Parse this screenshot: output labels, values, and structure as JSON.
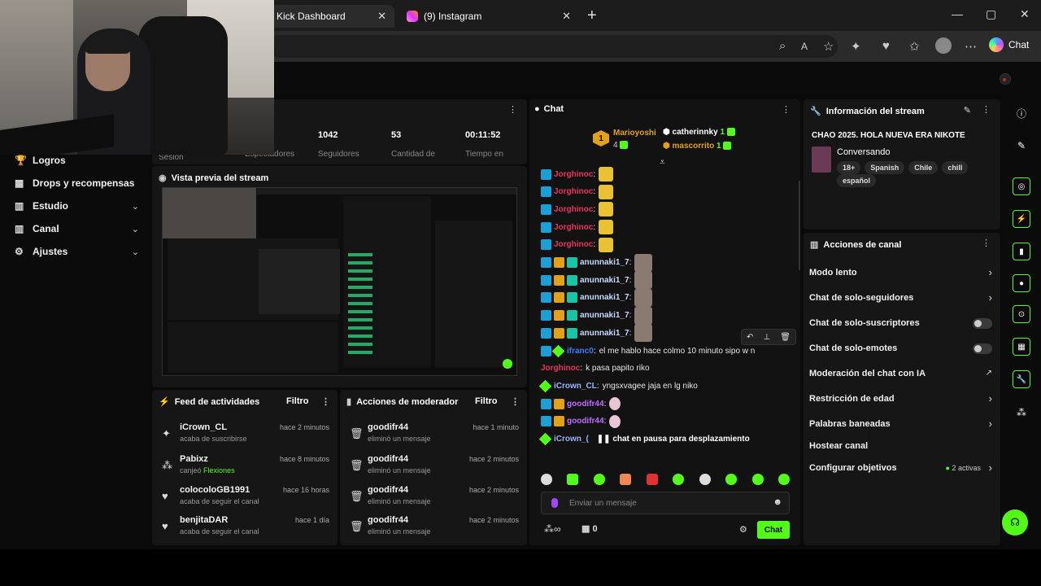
{
  "browser": {
    "tabs": [
      {
        "label": "Kick Dashboard"
      },
      {
        "label": "(9) Instagram"
      }
    ],
    "copilot_label": "Chat"
  },
  "nav": {
    "items": [
      {
        "label": "Logros",
        "icon": "trophy-icon"
      },
      {
        "label": "Drops y recompensas",
        "icon": "gift-icon"
      },
      {
        "label": "Estudio",
        "icon": "bars-icon"
      },
      {
        "label": "Canal",
        "icon": "bars-icon"
      },
      {
        "label": "Ajustes",
        "icon": "gear-icon"
      }
    ]
  },
  "stats": {
    "items": [
      {
        "value": "",
        "label": "Sesión"
      },
      {
        "value": "",
        "label": "Espectadores"
      },
      {
        "value": "1042",
        "label": "Seguidores"
      },
      {
        "value": "53",
        "label": "Cantidad de"
      },
      {
        "value": "00:11:52",
        "label": "Tiempo en"
      }
    ]
  },
  "preview": {
    "title": "Vista previa del stream"
  },
  "feed": {
    "title": "Feed de actividades",
    "filter": "Filtro",
    "items": [
      {
        "name": "iCrown_CL",
        "sub": "acaba de suscribirse",
        "time": "hace 2 minutos",
        "highlight": ""
      },
      {
        "name": "Pabixz",
        "sub": "canjeó",
        "time": "hace 8 minutos",
        "highlight": "Flexiones"
      },
      {
        "name": "colocoloGB1991",
        "sub": "acaba de seguir el canal",
        "time": "hace 16 horas",
        "highlight": ""
      },
      {
        "name": "benjitaDAR",
        "sub": "acaba de seguir el canal",
        "time": "hace 1 día",
        "highlight": ""
      }
    ]
  },
  "mod": {
    "title": "Acciones de moderador",
    "filter": "Filtro",
    "items": [
      {
        "name": "goodifr44",
        "sub": "eliminó un mensaje",
        "time": "hace 1 minuto"
      },
      {
        "name": "goodifr44",
        "sub": "eliminó un mensaje",
        "time": "hace 2 minutos"
      },
      {
        "name": "goodifr44",
        "sub": "eliminó un mensaje",
        "time": "hace 2 minutos"
      },
      {
        "name": "goodifr44",
        "sub": "eliminó un mensaje",
        "time": "hace 2 minutos"
      }
    ]
  },
  "chat": {
    "title": "Chat",
    "leaders": {
      "top": {
        "name": "Marioyoshi",
        "count": "4",
        "rank": "1"
      },
      "second": {
        "name": "catherinnky",
        "count": "1"
      },
      "third": {
        "name": "mascorrito",
        "count": "1"
      }
    },
    "messages": [
      {
        "user": "Jorghinoc",
        "text": "",
        "emote": "pika",
        "badges": 1,
        "color": "#e8335c"
      },
      {
        "user": "Jorghinoc",
        "text": "",
        "emote": "pika",
        "badges": 1,
        "color": "#e8335c"
      },
      {
        "user": "Jorghinoc",
        "text": "",
        "emote": "pika",
        "badges": 1,
        "color": "#e8335c"
      },
      {
        "user": "Jorghinoc",
        "text": "",
        "emote": "pika",
        "badges": 1,
        "color": "#e8335c"
      },
      {
        "user": "Jorghinoc",
        "text": "",
        "emote": "pika",
        "badges": 1,
        "color": "#e8335c"
      },
      {
        "user": "anunnaki1_7",
        "text": "",
        "emote": "face",
        "badges": 3,
        "color": "#c9d9ff"
      },
      {
        "user": "anunnaki1_7",
        "text": "",
        "emote": "face",
        "badges": 3,
        "color": "#c9d9ff"
      },
      {
        "user": "anunnaki1_7",
        "text": "",
        "emote": "face",
        "badges": 3,
        "color": "#c9d9ff"
      },
      {
        "user": "anunnaki1_7",
        "text": "",
        "emote": "face",
        "badges": 3,
        "color": "#c9d9ff"
      },
      {
        "user": "anunnaki1_7",
        "text": "",
        "emote": "face",
        "badges": 3,
        "color": "#c9d9ff"
      },
      {
        "user": "ifranc0",
        "text": "el me hablo hace colmo 10 minuto sipo w n",
        "emote": "",
        "badges": 4,
        "color": "#3b7cff"
      },
      {
        "user": "Jorghinoc",
        "text": "k pasa papito riko",
        "emote": "",
        "badges": 0,
        "color": "#e8335c"
      },
      {
        "user": "iCrown_CL",
        "text": "yngsxvagee jaja en lg niko",
        "emote": "",
        "badges": 5,
        "color": "#9fb4ff"
      },
      {
        "user": "goodifr44",
        "text": "",
        "emote": "ghost",
        "badges": 2,
        "color": "#c06bff"
      },
      {
        "user": "goodifr44",
        "text": "",
        "emote": "ghost",
        "badges": 2,
        "color": "#c06bff"
      },
      {
        "user": "iCrown_(",
        "text": "",
        "emote": "",
        "badges": 5,
        "color": "#9fb4ff"
      }
    ],
    "paused": "chat en pausa para desplazamiento",
    "input_placeholder": "Enviar un mensaje",
    "count": "0",
    "send": "Chat"
  },
  "info": {
    "title": "Información del stream",
    "stream_title": "CHAO 2025. HOLA NUEVA ERA NIKOTE",
    "category": "Conversando",
    "tags": [
      "18+",
      "Spanish",
      "Chile",
      "chill",
      "español"
    ]
  },
  "canal": {
    "title": "Acciones de canal",
    "items": [
      {
        "label": "Modo lento",
        "control": "chevron"
      },
      {
        "label": "Chat de solo-seguidores",
        "control": "chevron"
      },
      {
        "label": "Chat de solo-suscriptores",
        "control": "toggle"
      },
      {
        "label": "Chat de solo-emotes",
        "control": "toggle"
      },
      {
        "label": "Moderación del chat con IA",
        "control": "external"
      },
      {
        "label": "Restricción de edad",
        "control": "chevron"
      },
      {
        "label": "Palabras baneadas",
        "control": "chevron"
      },
      {
        "label": "Hostear canal",
        "control": "none"
      },
      {
        "label": "Configurar objetivos",
        "control": "chevron"
      }
    ],
    "goals_active": "2 activas"
  },
  "colors": {
    "accent": "#53fc18",
    "panel": "#161616",
    "bg": "#0a0a0a"
  }
}
